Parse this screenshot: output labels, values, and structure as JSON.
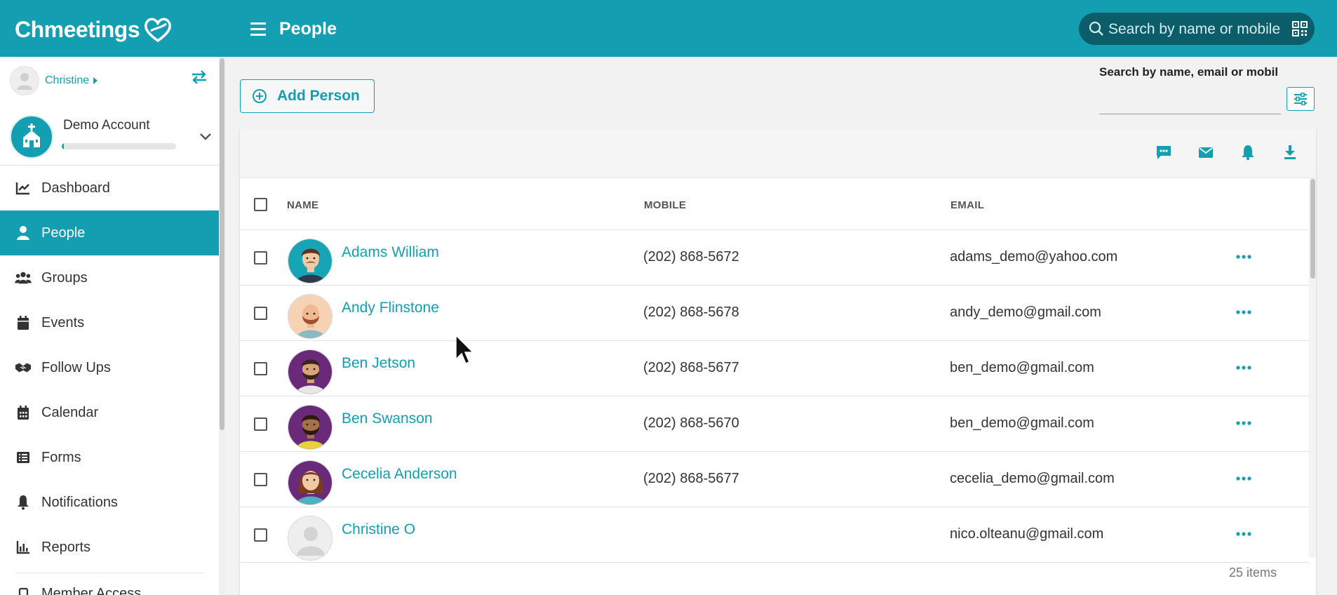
{
  "app": {
    "logo_text": "Chmeetings",
    "page_title": "People",
    "search_placeholder": "Search by name or mobile"
  },
  "sidebar": {
    "user_name": "Christine",
    "account_name": "Demo Account",
    "account_progress_fraction": 0.02,
    "items": [
      {
        "label": "Dashboard",
        "icon": "chart-line-icon",
        "active": false
      },
      {
        "label": "People",
        "icon": "person-icon",
        "active": true
      },
      {
        "label": "Groups",
        "icon": "users-icon",
        "active": false
      },
      {
        "label": "Events",
        "icon": "calendar-icon",
        "active": false
      },
      {
        "label": "Follow Ups",
        "icon": "handshake-icon",
        "active": false
      },
      {
        "label": "Calendar",
        "icon": "calendar-grid-icon",
        "active": false
      },
      {
        "label": "Forms",
        "icon": "list-icon",
        "active": false
      },
      {
        "label": "Notifications",
        "icon": "bell-icon",
        "active": false
      },
      {
        "label": "Reports",
        "icon": "bar-chart-icon",
        "active": false
      }
    ],
    "partial_item": "Member Access"
  },
  "main": {
    "add_person_label": "Add Person",
    "filter_label": "Search by name, email or mobile",
    "toolbar_icons": [
      "sms-icon",
      "email-icon",
      "bell-icon",
      "download-icon"
    ],
    "columns": {
      "name": "NAME",
      "mobile": "MOBILE",
      "email": "EMAIL"
    },
    "rows": [
      {
        "name": "Adams William",
        "mobile": "(202) 868-5672",
        "email": "adams_demo@yahoo.com"
      },
      {
        "name": "Andy Flinstone",
        "mobile": "(202) 868-5678",
        "email": "andy_demo@gmail.com"
      },
      {
        "name": "Ben Jetson",
        "mobile": "(202) 868-5677",
        "email": "ben_demo@gmail.com"
      },
      {
        "name": "Ben Swanson",
        "mobile": "(202) 868-5670",
        "email": "ben_demo@gmail.com"
      },
      {
        "name": "Cecelia Anderson",
        "mobile": "(202) 868-5677",
        "email": "cecelia_demo@gmail.com"
      },
      {
        "name": "Christine O",
        "mobile": "",
        "email": "nico.olteanu@gmail.com"
      }
    ],
    "item_count": "25 items"
  },
  "colors": {
    "brand": "#139eb1",
    "search_bg": "#0b5d69"
  }
}
